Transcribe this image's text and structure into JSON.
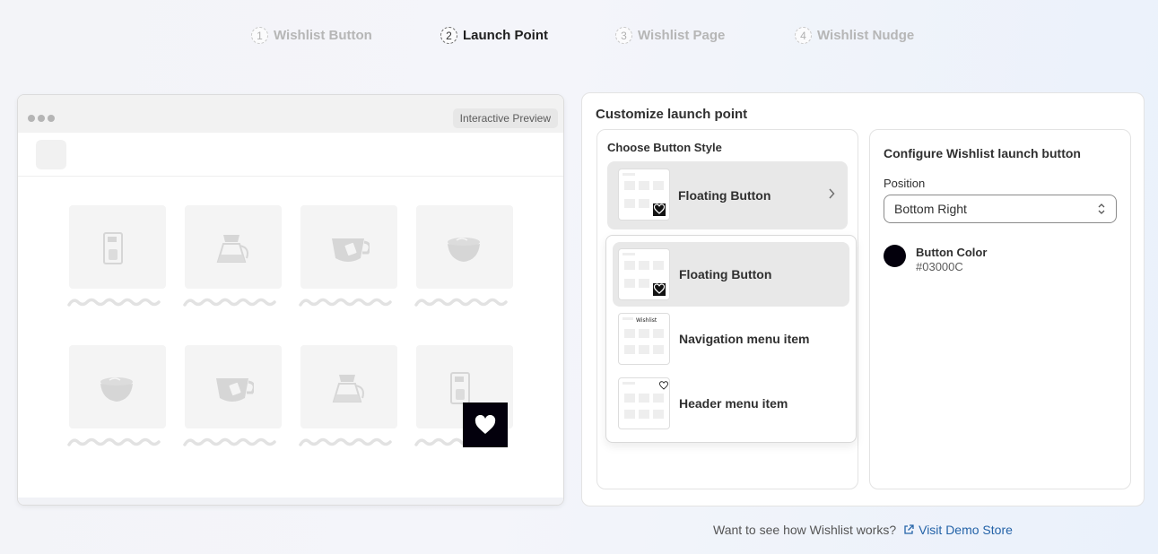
{
  "steps": [
    {
      "number": "1",
      "label": "Wishlist Button",
      "active": false
    },
    {
      "number": "2",
      "label": "Launch Point",
      "active": true
    },
    {
      "number": "3",
      "label": "Wishlist Page",
      "active": false
    },
    {
      "number": "4",
      "label": "Wishlist Nudge",
      "active": false
    }
  ],
  "preview": {
    "badge": "Interactive Preview",
    "products": [
      {
        "icon": "coffee-machine-icon"
      },
      {
        "icon": "coffee-pot-icon"
      },
      {
        "icon": "tea-cup-icon"
      },
      {
        "icon": "latte-bowl-icon"
      },
      {
        "icon": "latte-bowl-icon"
      },
      {
        "icon": "tea-cup-icon"
      },
      {
        "icon": "coffee-pot-icon"
      },
      {
        "icon": "coffee-machine-icon"
      }
    ],
    "floating_button_icon": "heart-icon"
  },
  "customize": {
    "title": "Customize launch point",
    "choose_style_label": "Choose Button Style",
    "selected_style": "Floating Button",
    "options": [
      {
        "label": "Floating Button",
        "selected": true
      },
      {
        "label": "Navigation menu item",
        "thumb_text": "Wishlist",
        "selected": false
      },
      {
        "label": "Header menu item",
        "selected": false
      }
    ]
  },
  "configure": {
    "title": "Configure Wishlist launch button",
    "position_label": "Position",
    "position_value": "Bottom Right",
    "color_label": "Button Color",
    "color_value": "#03000C"
  },
  "footer": {
    "prompt": "Want to see how Wishlist works?",
    "link": "Visit Demo Store"
  },
  "colors": {
    "accent_link": "#2463a8",
    "button_color": "#03000C",
    "active_step": "#1f1f1f",
    "inactive_step": "#b6b6b6"
  }
}
